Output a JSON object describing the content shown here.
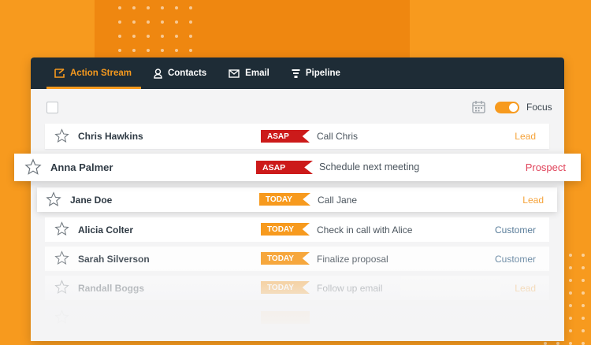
{
  "nav": {
    "tabs": [
      {
        "label": "Action Stream",
        "icon": "action-stream-icon"
      },
      {
        "label": "Contacts",
        "icon": "contacts-icon"
      },
      {
        "label": "Email",
        "icon": "email-icon"
      },
      {
        "label": "Pipeline",
        "icon": "pipeline-icon"
      }
    ]
  },
  "toolbar": {
    "focus_label": "Focus",
    "focus_on": true
  },
  "rows": [
    {
      "name": "Chris Hawkins",
      "badge": "ASAP",
      "task": "Call Chris",
      "status": "Lead"
    },
    {
      "name": "Anna Palmer",
      "badge": "ASAP",
      "task": "Schedule next meeting",
      "status": "Prospect"
    },
    {
      "name": "Jane Doe",
      "badge": "TODAY",
      "task": "Call Jane",
      "status": "Lead"
    },
    {
      "name": "Alicia Colter",
      "badge": "TODAY",
      "task": "Check in call with Alice",
      "status": "Customer"
    },
    {
      "name": "Sarah Silverson",
      "badge": "TODAY",
      "task": "Finalize proposal",
      "status": "Customer"
    },
    {
      "name": "Randall Boggs",
      "badge": "TODAY",
      "task": "Follow up email",
      "status": "Lead"
    }
  ],
  "colors": {
    "accent": "#f79a1e",
    "nav_bg": "#1e2c36",
    "asap": "#cc1a1a",
    "today": "#f79a1e",
    "lead": "#f5a33a",
    "prospect": "#e0435a",
    "customer": "#5a7d9a"
  }
}
